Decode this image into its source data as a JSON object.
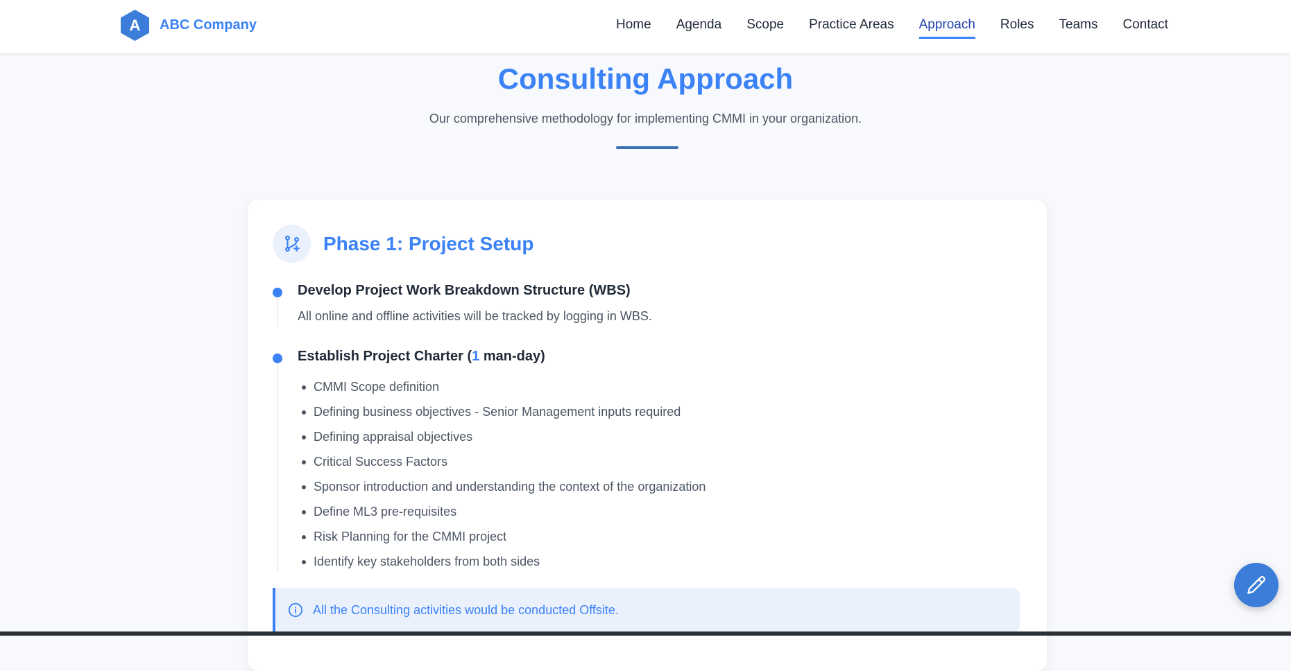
{
  "brand": {
    "logo_letter": "A",
    "name": "ABC Company"
  },
  "nav": {
    "items": [
      {
        "label": "Home"
      },
      {
        "label": "Agenda"
      },
      {
        "label": "Scope"
      },
      {
        "label": "Practice Areas"
      },
      {
        "label": "Approach",
        "active": true
      },
      {
        "label": "Roles"
      },
      {
        "label": "Teams"
      },
      {
        "label": "Contact"
      }
    ]
  },
  "hero": {
    "title": "Consulting Approach",
    "subtitle": "Our comprehensive methodology for implementing CMMI in your organization."
  },
  "phase": {
    "icon": "git-branch-plus-icon",
    "title": "Phase 1: Project Setup",
    "steps": [
      {
        "title": "Develop Project Work Breakdown Structure (WBS)",
        "description": "All online and offline activities will be tracked by logging in WBS."
      },
      {
        "title_prefix": "Establish Project Charter (",
        "title_accent": "1",
        "title_suffix": " man-day)",
        "bullets": [
          "CMMI Scope definition",
          "Defining business objectives - Senior Management inputs required",
          "Defining appraisal objectives",
          "Critical Success Factors",
          "Sponsor introduction and understanding the context of the organization",
          "Define ML3 pre-requisites",
          "Risk Planning for the CMMI project",
          "Identify key stakeholders from both sides"
        ]
      }
    ],
    "note": {
      "icon": "info-icon",
      "text": "All the Consulting activities would be conducted Offsite."
    }
  },
  "fab": {
    "icon": "pencil-icon"
  },
  "colors": {
    "accent": "#3b82f6",
    "text": "#1f2937",
    "muted": "#4b5563",
    "background": "#f7f9fc"
  }
}
